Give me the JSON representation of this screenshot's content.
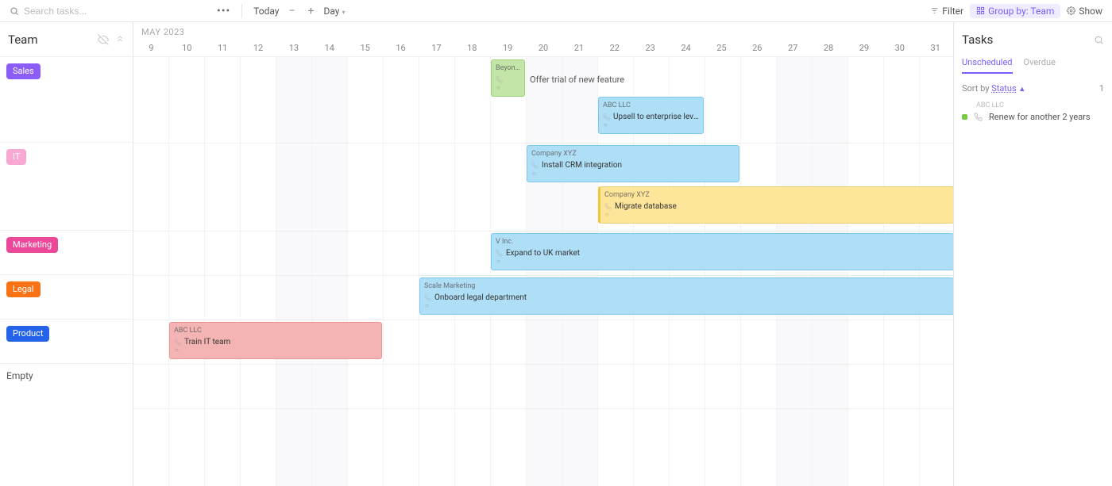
{
  "toolbar": {
    "search_placeholder": "Search tasks...",
    "today": "Today",
    "day_label": "Day",
    "filter": "Filter",
    "group_by": "Group by: Team",
    "show": "Show"
  },
  "left": {
    "header": "Team",
    "rows": [
      "Sales",
      "IT",
      "Marketing",
      "Legal",
      "Product",
      "Empty"
    ]
  },
  "timeline": {
    "month": "MAY 2023",
    "days": [
      9,
      10,
      11,
      12,
      13,
      14,
      15,
      16,
      17,
      18,
      19,
      20,
      21,
      22,
      23,
      24,
      25,
      26,
      27,
      28,
      29,
      30,
      31
    ],
    "weekend_days": [
      13,
      14,
      20,
      21,
      27,
      28
    ]
  },
  "tasks": [
    {
      "id": "t1",
      "row": 0,
      "start": 19,
      "end": 20,
      "color": "green",
      "company": "Beyond I...",
      "title": ""
    },
    {
      "id": "t1_float",
      "row": 0,
      "floatAfter": 20,
      "float_text": "Offer trial of new feature"
    },
    {
      "id": "t2",
      "row": 0,
      "start": 22,
      "end": 25,
      "color": "blue",
      "company": "ABC LLC",
      "title": "Upsell to enterprise level",
      "yOffset": 50
    },
    {
      "id": "t3",
      "row": 1,
      "start": 20,
      "end": 26,
      "color": "blue",
      "company": "Company XYZ",
      "title": "Install CRM integration"
    },
    {
      "id": "t4",
      "row": 1,
      "start": 22,
      "end": 32,
      "color": "yellow",
      "company": "Company XYZ",
      "title": "Migrate database",
      "yOffset": 55
    },
    {
      "id": "t5",
      "row": 2,
      "start": 19,
      "end": 32,
      "color": "blue",
      "company": "V Inc.",
      "title": "Expand to UK market"
    },
    {
      "id": "t6",
      "row": 3,
      "start": 17,
      "end": 32,
      "color": "blue",
      "company": "Scale Marketing",
      "title": "Onboard legal department"
    },
    {
      "id": "t7",
      "row": 4,
      "start": 10,
      "end": 16,
      "color": "red",
      "company": "ABC LLC",
      "title": "Train IT team"
    }
  ],
  "right": {
    "title": "Tasks",
    "tab_unscheduled": "Unscheduled",
    "tab_overdue": "Overdue",
    "sort_by_label": "Sort by",
    "sort_by_value": "Status",
    "count": "1",
    "item": {
      "company": "ABC LLC",
      "title": "Renew for another 2 years"
    }
  }
}
